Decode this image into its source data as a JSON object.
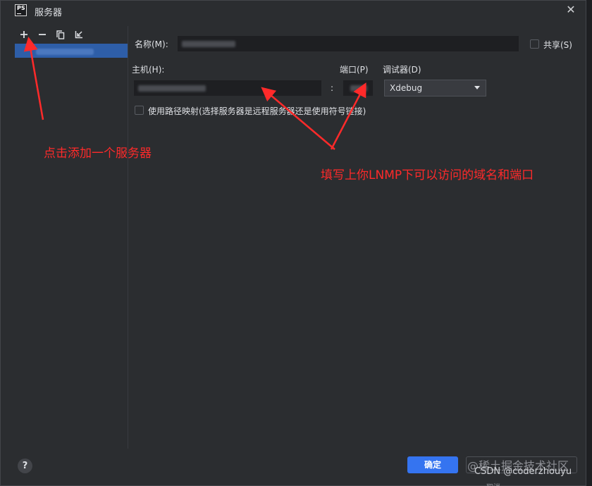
{
  "window": {
    "title": "服务器",
    "app_icon": "PS",
    "close_glyph": "✕"
  },
  "toolbar": {
    "icons": [
      "plus-icon",
      "minus-icon",
      "copy-icon",
      "import-icon"
    ]
  },
  "form": {
    "name_label": "名称(M):",
    "share_label": "共享(S)",
    "host_label": "主机(H):",
    "colon": ":",
    "port_label": "端口(P)",
    "debugger_label": "调试器(D)",
    "debugger_value": "Xdebug",
    "path_mapping_label": "使用路径映射(选择服务器是远程服务器还是使用符号链接)"
  },
  "annotations": {
    "add_server": "点击添加一个服务器",
    "fill_host": "填写上你LNMP下可以访问的域名和端口"
  },
  "footer": {
    "help": "?",
    "ok": "确定",
    "cancel_partial": "取消"
  },
  "watermark": {
    "line1": "@稀土掘金技术社区",
    "line2": "CSDN @coderzhouyu"
  },
  "colors": {
    "accent": "#3574f0",
    "annotation": "#ff2a2a",
    "selected_row": "#2e5ea8"
  }
}
